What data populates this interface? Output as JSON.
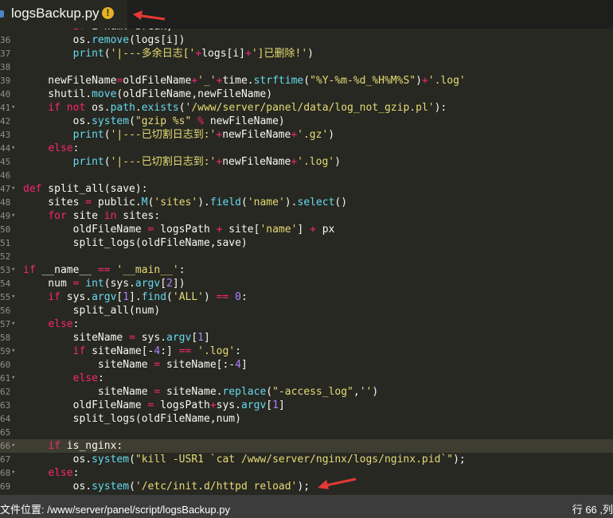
{
  "tab": {
    "title": "logsBackup.py",
    "warning": "!"
  },
  "editor": {
    "lines": [
      {
        "n": "36",
        "code": "        os.remove(logs[i])"
      },
      {
        "n": "37",
        "code": "        print('|---多余日志['+logs[i]+']已删除!')"
      },
      {
        "n": "38",
        "code": ""
      },
      {
        "n": "39",
        "code": "    newFileName=oldFileName+'_'+time.strftime(\"%Y-%m-%d_%H%M%S\")+'.log'"
      },
      {
        "n": "40",
        "code": "    shutil.move(oldFileName,newFileName)"
      },
      {
        "n": "41",
        "code": "    if not os.path.exists('/www/server/panel/data/log_not_gzip.pl'):"
      },
      {
        "n": "42",
        "code": "        os.system(\"gzip %s\" % newFileName)"
      },
      {
        "n": "43",
        "code": "        print('|---已切割日志到:'+newFileName+'.gz')"
      },
      {
        "n": "44",
        "code": "    else:"
      },
      {
        "n": "45",
        "code": "        print('|---已切割日志到:'+newFileName+'.log')"
      },
      {
        "n": "46",
        "code": ""
      },
      {
        "n": "47",
        "code": "def split_all(save):"
      },
      {
        "n": "48",
        "code": "    sites = public.M('sites').field('name').select()"
      },
      {
        "n": "49",
        "code": "    for site in sites:"
      },
      {
        "n": "50",
        "code": "        oldFileName = logsPath + site['name'] + px"
      },
      {
        "n": "51",
        "code": "        split_logs(oldFileName,save)"
      },
      {
        "n": "52",
        "code": ""
      },
      {
        "n": "53",
        "code": "if __name__ == '__main__':"
      },
      {
        "n": "54",
        "code": "    num = int(sys.argv[2])"
      },
      {
        "n": "55",
        "code": "    if sys.argv[1].find('ALL') == 0:"
      },
      {
        "n": "56",
        "code": "        split_all(num)"
      },
      {
        "n": "57",
        "code": "    else:"
      },
      {
        "n": "58",
        "code": "        siteName = sys.argv[1]"
      },
      {
        "n": "59",
        "code": "        if siteName[-4:] == '.log':"
      },
      {
        "n": "60",
        "code": "            siteName = siteName[:-4]"
      },
      {
        "n": "61",
        "code": "        else:"
      },
      {
        "n": "62",
        "code": "            siteName = siteName.replace(\"-access_log\",'')"
      },
      {
        "n": "63",
        "code": "        oldFileName = logsPath+sys.argv[1]"
      },
      {
        "n": "64",
        "code": "        split_logs(oldFileName,num)"
      },
      {
        "n": "65",
        "code": ""
      },
      {
        "n": "66",
        "code": "    if is_nginx:"
      },
      {
        "n": "67",
        "code": "        os.system(\"kill -USR1 `cat /www/server/nginx/logs/nginx.pid`\");"
      },
      {
        "n": "68",
        "code": "    else:"
      },
      {
        "n": "69",
        "code": "        os.system('/etc/init.d/httpd reload');"
      }
    ],
    "top_partial": "        if i>num: break;",
    "cursor_line": "66"
  },
  "status": {
    "path": "文件位置: /www/server/panel/script/logsBackup.py",
    "position": "行 66 ,列"
  },
  "colors": {
    "background": "#272822",
    "keyword": "#f92672",
    "string": "#e6db74",
    "builtin": "#66d9ef",
    "number": "#ae81ff",
    "annotation_arrow": "#e53935"
  }
}
